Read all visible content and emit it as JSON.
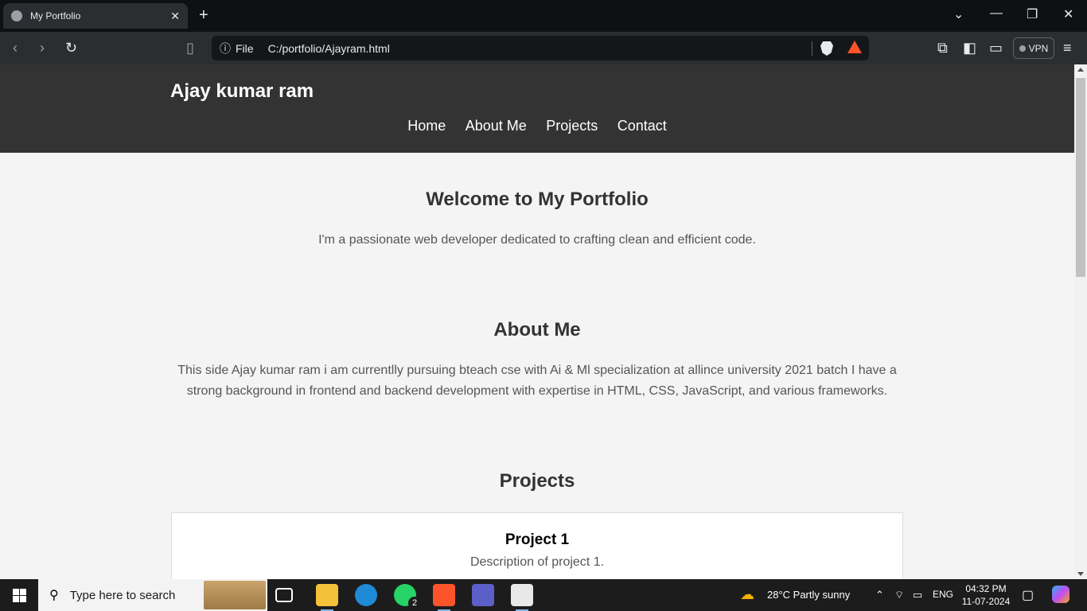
{
  "browser": {
    "tab_title": "My Portfolio",
    "tab_close": "✕",
    "new_tab": "+",
    "url_scheme_label": "File",
    "url": "C:/portfolio/Ajayram.html",
    "vpn_label": "VPN"
  },
  "site": {
    "title": "Ajay kumar ram",
    "nav": [
      "Home",
      "About Me",
      "Projects",
      "Contact"
    ]
  },
  "hero": {
    "heading": "Welcome to My Portfolio",
    "text": "I'm a passionate web developer dedicated to crafting clean and efficient code."
  },
  "about": {
    "heading": "About Me",
    "text": "This side Ajay kumar ram i am currentlly pursuing bteach cse with Ai & Ml specialization at allince university 2021 batch I have a strong background in frontend and backend development with expertise in HTML, CSS, JavaScript, and various frameworks."
  },
  "projects": {
    "heading": "Projects",
    "items": [
      {
        "title": "Project 1",
        "description": "Description of project 1."
      }
    ]
  },
  "taskbar": {
    "search_placeholder": "Type here to search",
    "whatsapp_badge": "2",
    "weather": "28°C  Partly sunny",
    "language": "ENG",
    "time": "04:32 PM",
    "date": "11-07-2024"
  },
  "colors": {
    "header_bg": "#333333",
    "page_bg": "#f4f4f4"
  }
}
